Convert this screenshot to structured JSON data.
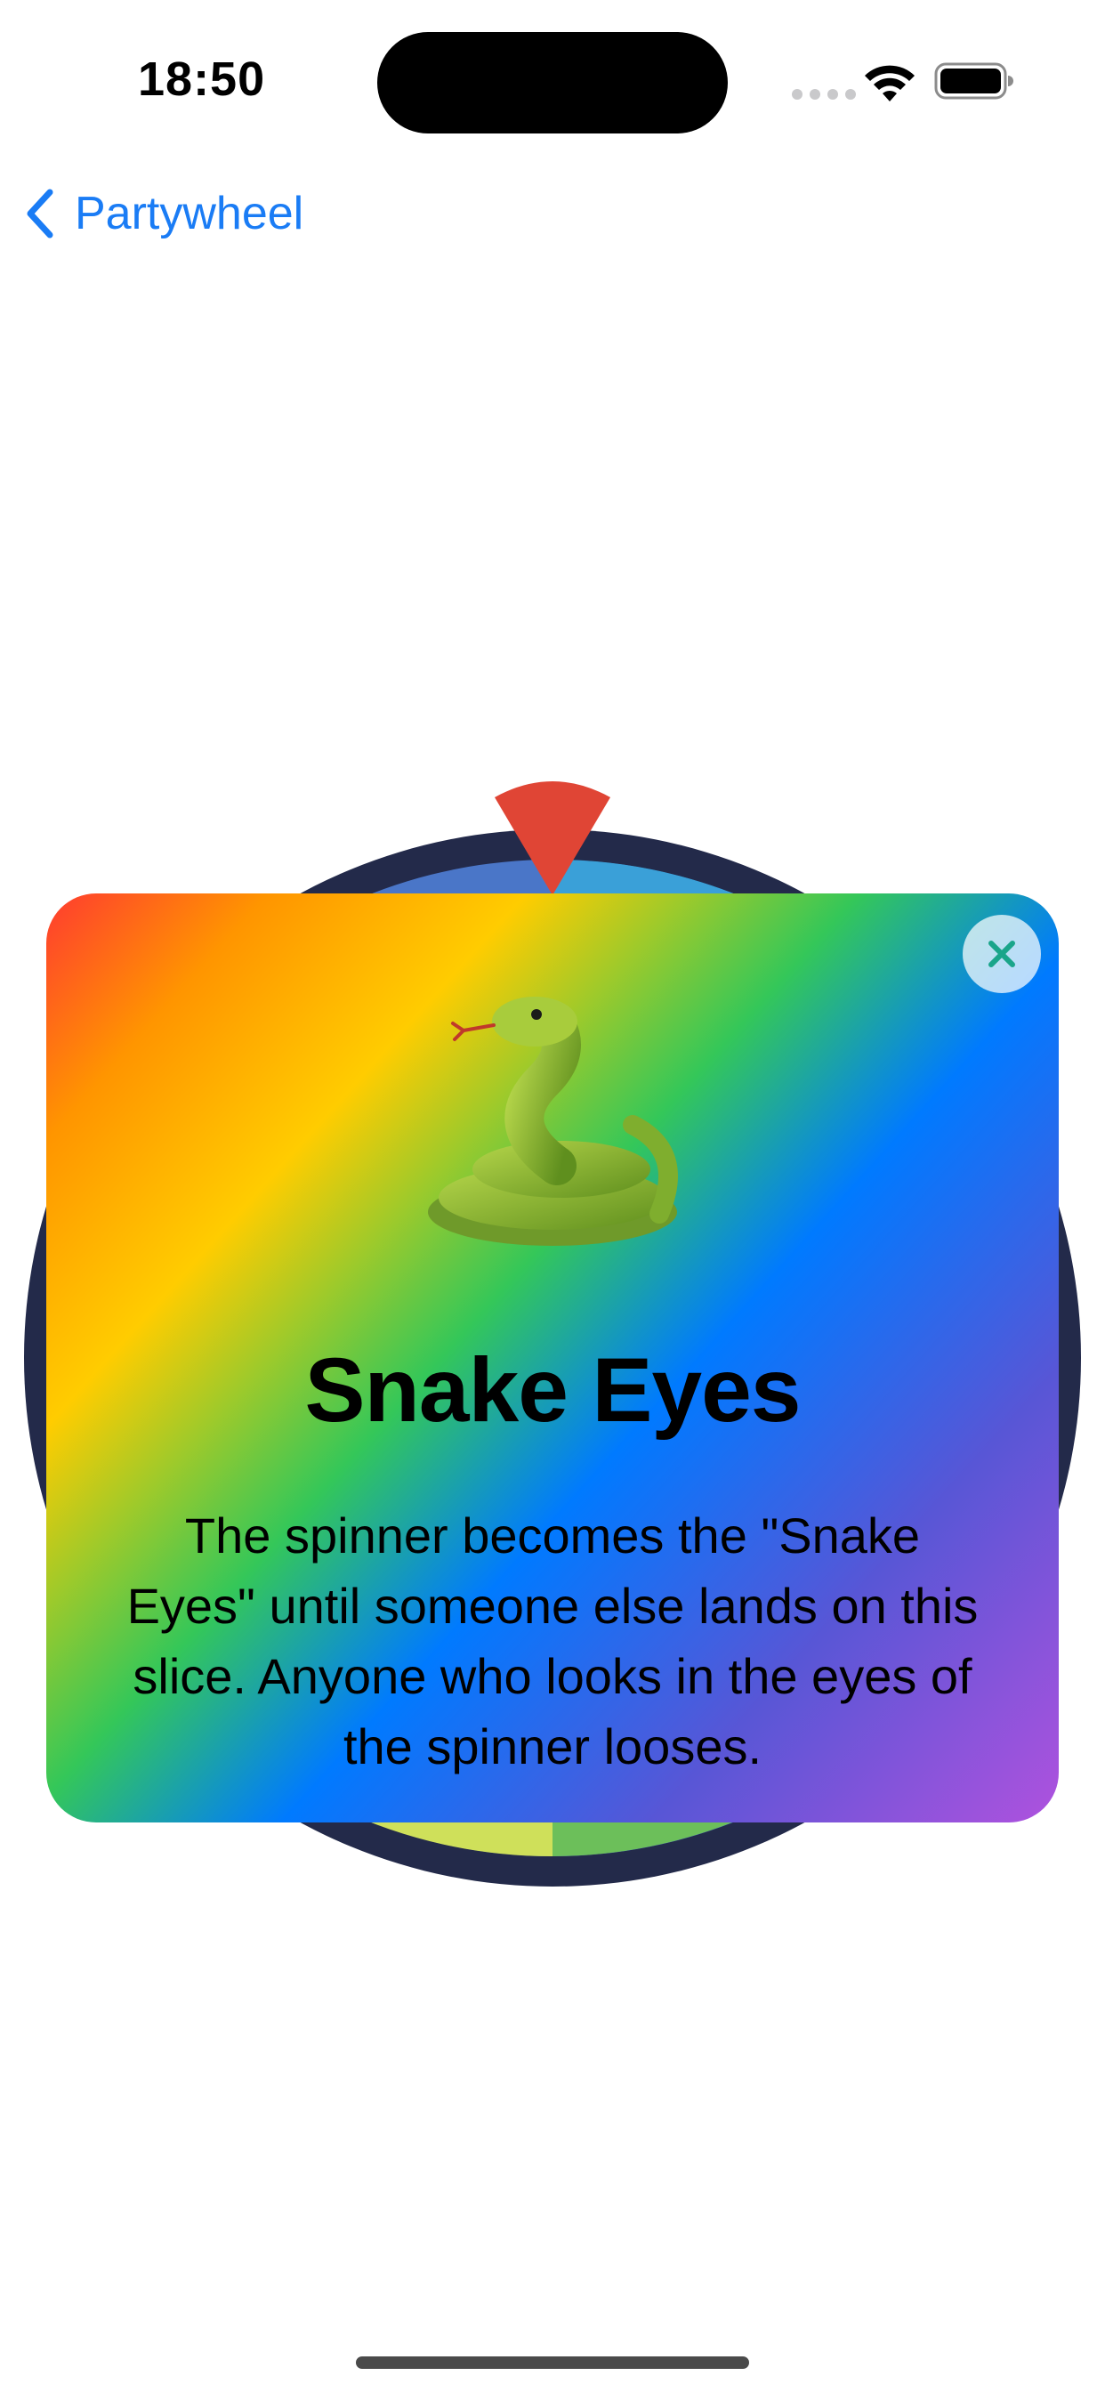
{
  "status_bar": {
    "time": "18:50",
    "icons": [
      "cellular-signal-icon",
      "wifi-icon",
      "battery-icon"
    ]
  },
  "nav": {
    "back_label": "Partywheel",
    "back_icon": "chevron-left-icon"
  },
  "colors": {
    "accent": "#1a7cf5",
    "wheel_rim": "#232a4a",
    "pointer": "#e04535"
  },
  "card": {
    "emoji_icon": "snake-icon",
    "title": "Snake Eyes",
    "description": "The spinner becomes the \"Snake Eyes\" until someone else lands on this slice. Anyone who looks in the eyes of the spinner looses.",
    "close_icon": "close-icon"
  }
}
